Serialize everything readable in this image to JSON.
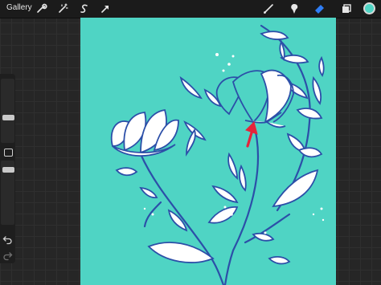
{
  "toolbar": {
    "gallery_label": "Gallery",
    "left_tools": [
      "wrench-icon",
      "magic-wand-icon",
      "selection-icon",
      "transform-arrow-icon"
    ],
    "right_tools": [
      "brush-icon",
      "smudge-icon",
      "eraser-icon",
      "layers-icon"
    ],
    "current_color": "#4fd4c4"
  },
  "sidebar": {
    "controls": [
      "brush-size-slider",
      "modify-button",
      "opacity-slider",
      "undo-button",
      "redo-button"
    ]
  },
  "canvas": {
    "background_color": "#4fd4c4",
    "ink_color": "#2c4fa8",
    "fill_color": "#ffffff",
    "annotation_color": "#e5243b"
  }
}
